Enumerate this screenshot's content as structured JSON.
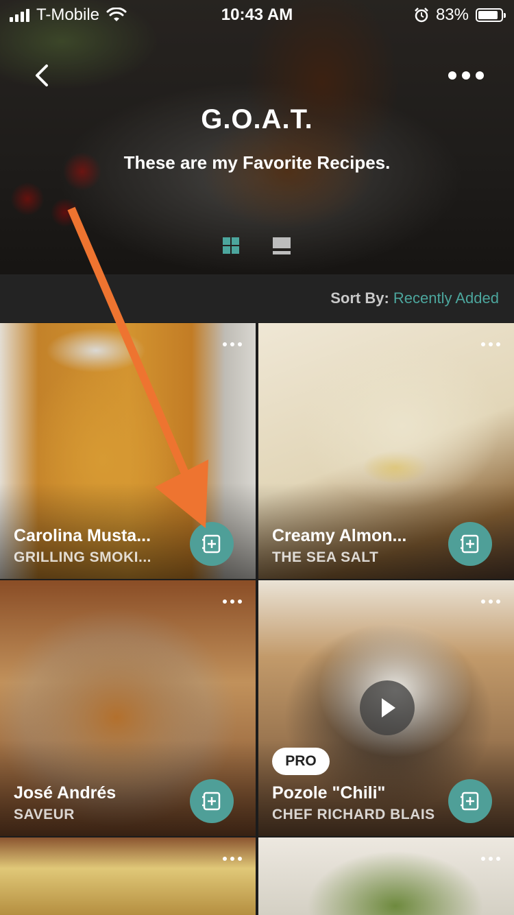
{
  "status_bar": {
    "carrier": "T-Mobile",
    "time": "10:43 AM",
    "battery": "83%"
  },
  "header": {
    "title": "G.O.A.T.",
    "subtitle": "These are my Favorite Recipes."
  },
  "sort": {
    "label": "Sort By:",
    "value": "Recently Added"
  },
  "recipes": [
    {
      "title": "Carolina Musta...",
      "source": "GRILLING SMOKI..."
    },
    {
      "title": "Creamy Almon...",
      "source": "THE SEA SALT"
    },
    {
      "title": "José Andrés",
      "source": "SAVEUR"
    },
    {
      "title": "Pozole \"Chili\"",
      "source": "CHEF RICHARD BLAIS",
      "badge": "PRO"
    }
  ],
  "colors": {
    "accent": "#4ca69d",
    "add_button": "#4f9f98",
    "annotation_arrow": "#ee7430"
  }
}
